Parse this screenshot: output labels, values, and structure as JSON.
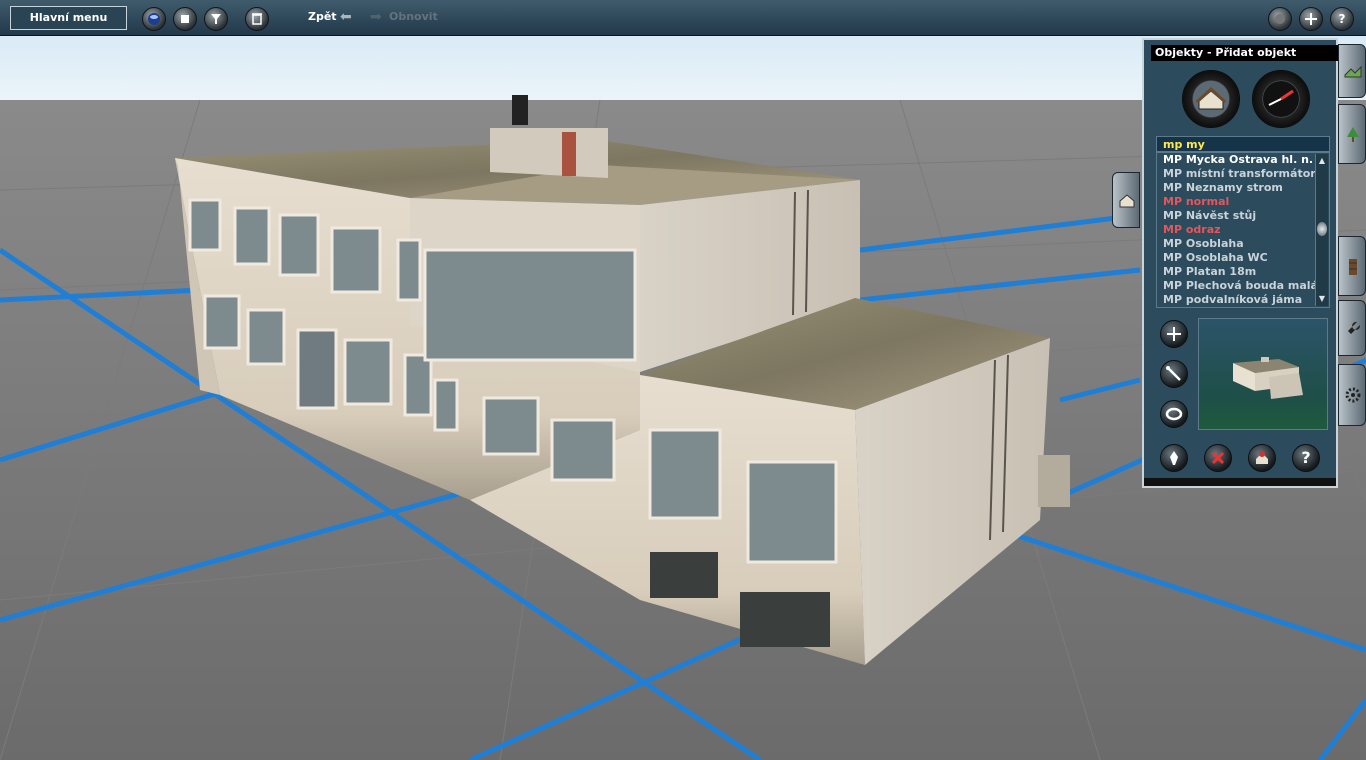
{
  "toolbar": {
    "main_menu_label": "Hlavní menu",
    "undo_label": "Zpět",
    "redo_label": "Obnovit",
    "left_icons": [
      "globe-icon",
      "stop-icon",
      "filter-icon",
      "trash-icon"
    ],
    "right_icons": [
      "light-icon",
      "plus-icon",
      "help-icon"
    ]
  },
  "panel": {
    "title": "Objekty - Přidat objekt",
    "filter_text": "mp my",
    "items": [
      {
        "label": "MP Mycka Ostrava hl. n.",
        "state": "selected"
      },
      {
        "label": "MP místní transformátor",
        "state": "normal"
      },
      {
        "label": "MP Neznamy strom",
        "state": "normal"
      },
      {
        "label": "MP normal",
        "state": "red"
      },
      {
        "label": "MP Návěst stůj",
        "state": "normal"
      },
      {
        "label": "MP odraz",
        "state": "red"
      },
      {
        "label": "MP Osoblaha",
        "state": "normal"
      },
      {
        "label": "MP Osoblaha WC",
        "state": "normal"
      },
      {
        "label": "MP Platan 18m",
        "state": "normal"
      },
      {
        "label": "MP Plechová bouda malá",
        "state": "normal"
      },
      {
        "label": "MP podvalníková jáma",
        "state": "normal"
      }
    ],
    "side_tools": [
      "add-icon",
      "move-icon",
      "rotate-icon"
    ],
    "bottom_tools": [
      "eyedropper-icon",
      "delete-icon",
      "object-info-icon",
      "help-icon"
    ]
  },
  "side_tabs": [
    "objects-tab",
    "terrain-tab",
    "trees-tab",
    "track-tab",
    "tools-tab",
    "settings-tab"
  ],
  "colors": {
    "accent": "#ffe94a",
    "grid_line": "#1f7fd6",
    "panel_bg": "#2c4b5c",
    "highlight_red": "#e8555a"
  }
}
